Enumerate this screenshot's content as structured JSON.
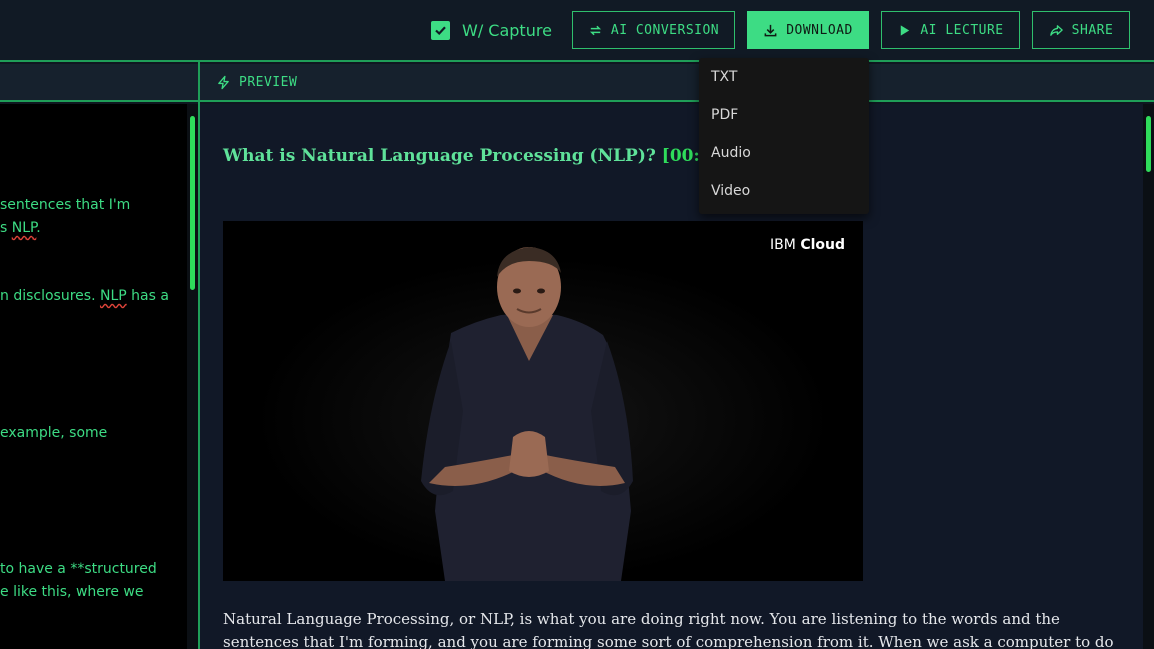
{
  "toolbar": {
    "capture_label": "W/ Capture",
    "capture_checked": true,
    "ai_conversion_label": "AI CONVERSION",
    "download_label": "DOWNLOAD",
    "ai_lecture_label": "AI LECTURE",
    "share_label": "SHARE"
  },
  "download_menu": {
    "items": [
      "TXT",
      "PDF",
      "Audio",
      "Video"
    ]
  },
  "editor": {
    "lines": [
      {
        "before": "sentences that I'm",
        "spell": "",
        "after": ""
      },
      {
        "before": "s ",
        "spell": "NLP",
        "after": "."
      },
      {
        "before": "n disclosures. ",
        "spell": "NLP",
        "after": " has a"
      },
      {
        "before": "example, some",
        "spell": "",
        "after": ""
      },
      {
        "before": "to have a **structured",
        "spell": "",
        "after": ""
      },
      {
        "before": "e like this, where we",
        "spell": "",
        "after": ""
      }
    ]
  },
  "preview": {
    "header_label": "PREVIEW",
    "title": "What is Natural Language Processing (NLP)?",
    "timestamp": "[00:00:0",
    "video_watermark_prefix": "IBM",
    "video_watermark_brand": "Cloud",
    "paragraph": "Natural Language Processing, or NLP, is what you are doing right now. You are listening to the words and the sentences that I'm forming, and you are forming some sort of comprehension from it. When we ask a computer to do"
  },
  "colors": {
    "accent": "#3ddc84",
    "panel_bg": "#111827",
    "header_bg": "#16212d",
    "border": "#1f9e58"
  }
}
